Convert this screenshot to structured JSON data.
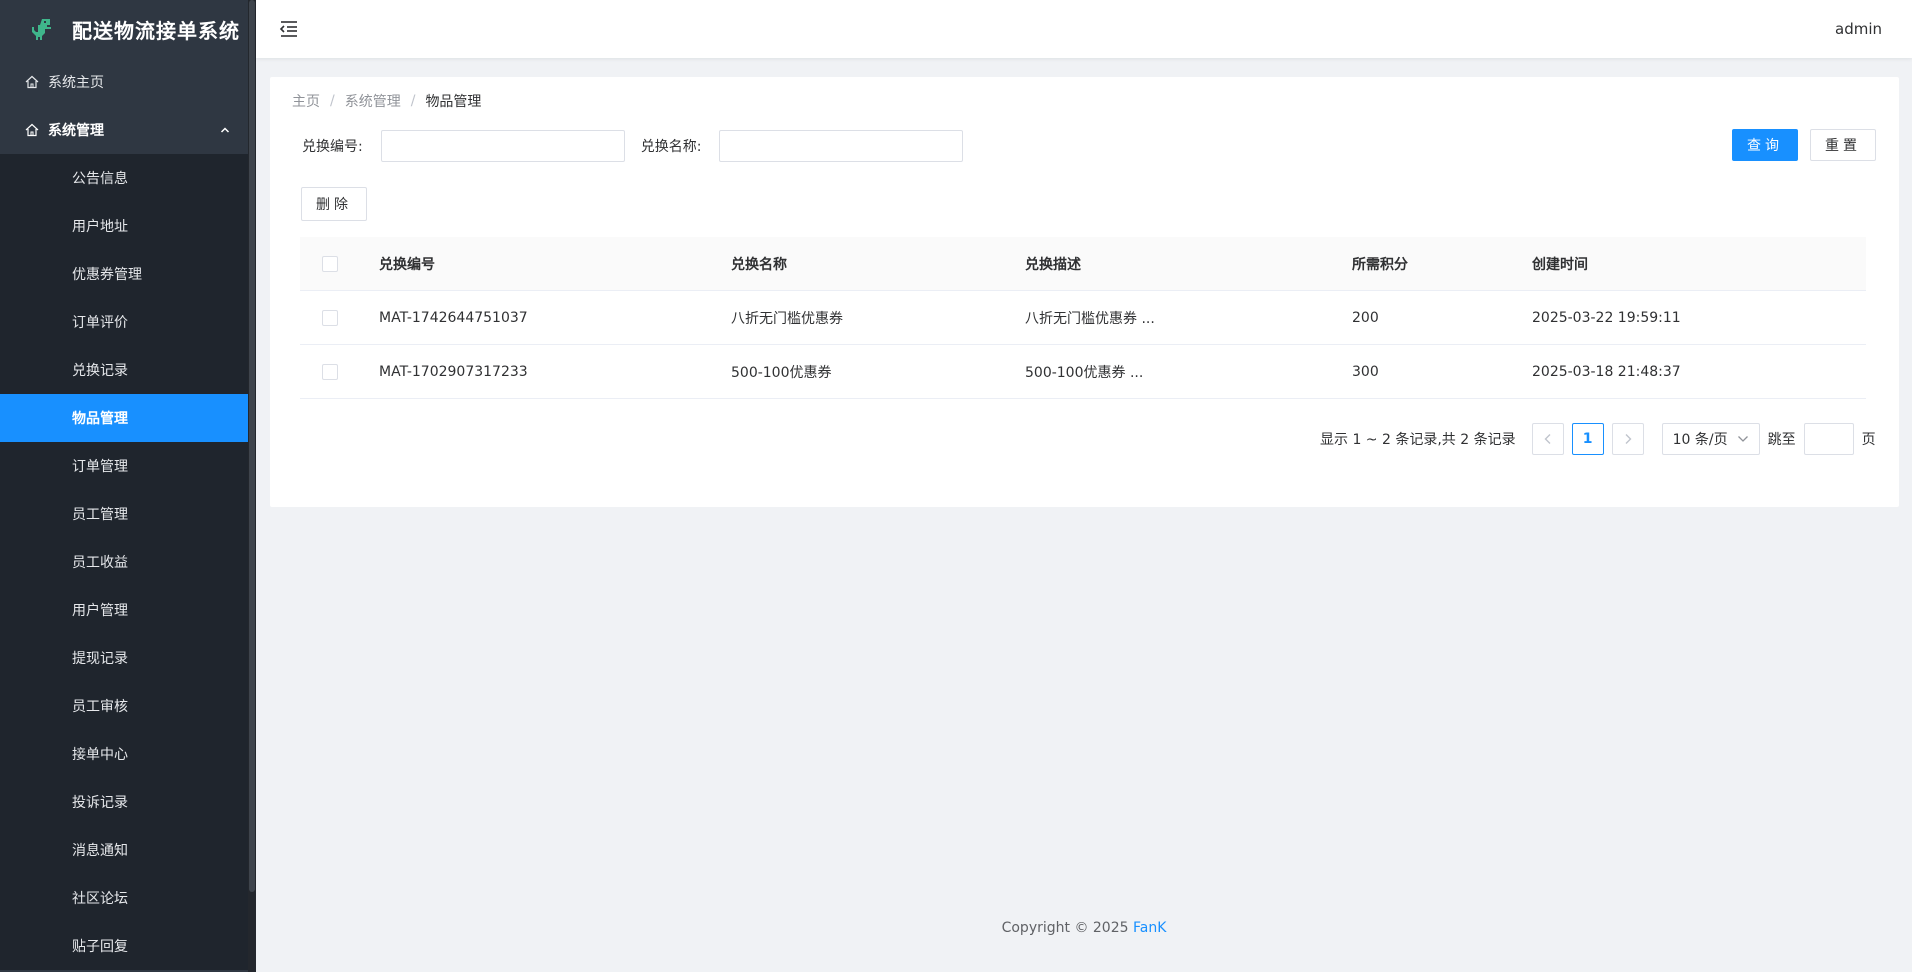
{
  "app": {
    "title": "配送物流接单系统"
  },
  "header": {
    "user": "admin"
  },
  "sidebar": {
    "home_label": "系统主页",
    "group_label": "系统管理",
    "items": [
      {
        "label": "公告信息",
        "active": false
      },
      {
        "label": "用户地址",
        "active": false
      },
      {
        "label": "优惠券管理",
        "active": false
      },
      {
        "label": "订单评价",
        "active": false
      },
      {
        "label": "兑换记录",
        "active": false
      },
      {
        "label": "物品管理",
        "active": true
      },
      {
        "label": "订单管理",
        "active": false
      },
      {
        "label": "员工管理",
        "active": false
      },
      {
        "label": "员工收益",
        "active": false
      },
      {
        "label": "用户管理",
        "active": false
      },
      {
        "label": "提现记录",
        "active": false
      },
      {
        "label": "员工审核",
        "active": false
      },
      {
        "label": "接单中心",
        "active": false
      },
      {
        "label": "投诉记录",
        "active": false
      },
      {
        "label": "消息通知",
        "active": false
      },
      {
        "label": "社区论坛",
        "active": false
      },
      {
        "label": "贴子回复",
        "active": false
      }
    ]
  },
  "breadcrumb": {
    "home": "主页",
    "section": "系统管理",
    "current": "物品管理",
    "separator": "/"
  },
  "search": {
    "code_label": "兑换编号:",
    "code_value": "",
    "name_label": "兑换名称:",
    "name_value": "",
    "query_label": "查询",
    "reset_label": "重置"
  },
  "toolbar": {
    "delete_label": "删除"
  },
  "table": {
    "headers": {
      "code": "兑换编号",
      "name": "兑换名称",
      "desc": "兑换描述",
      "points": "所需积分",
      "time": "创建时间"
    },
    "rows": [
      {
        "code": "MAT-1742644751037",
        "name": "八折无门槛优惠券",
        "desc": "八折无门槛优惠券 ...",
        "points": "200",
        "time": "2025-03-22 19:59:11"
      },
      {
        "code": "MAT-1702907317233",
        "name": "500-100优惠券",
        "desc": "500-100优惠券 ...",
        "points": "300",
        "time": "2025-03-18 21:48:37"
      }
    ]
  },
  "pagination": {
    "total_text": "显示 1 ~ 2 条记录,共 2 条记录",
    "current_page": "1",
    "page_size": "10 条/页",
    "jump_label": "跳至",
    "page_label": "页"
  },
  "footer": {
    "copyright": "Copyright © 2025 ",
    "author": "FanK"
  },
  "colors": {
    "accent": "#1890ff",
    "sidebar_bg": "#2f3742",
    "submenu_bg": "#1f252d"
  }
}
